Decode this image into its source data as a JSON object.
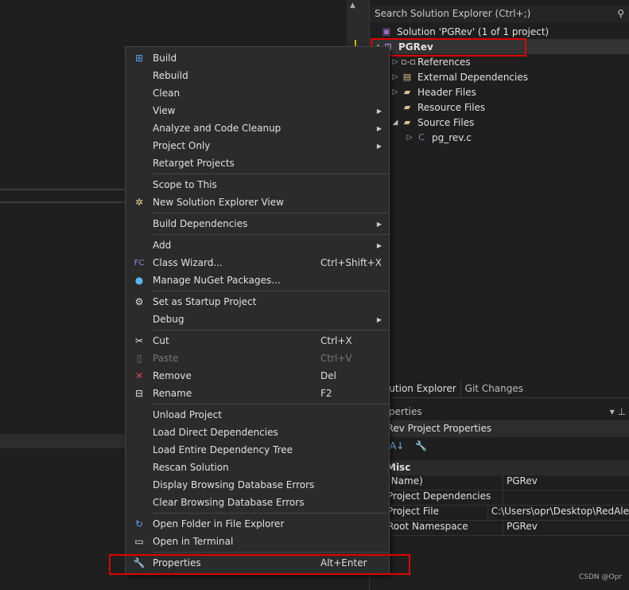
{
  "solution_explorer": {
    "search_placeholder": "Search Solution Explorer (Ctrl+;)",
    "solution": "Solution 'PGRev' (1 of 1 project)",
    "project": "PGRev",
    "items": [
      "References",
      "External Dependencies",
      "Header Files",
      "Resource Files",
      "Source Files"
    ],
    "file": "pg_rev.c"
  },
  "tabs": [
    "Solution Explorer",
    "Git Changes"
  ],
  "properties": {
    "title": "Properties",
    "header": "PGRev  Project Properties",
    "category": "Misc",
    "rows": [
      {
        "k": "(Name)",
        "v": "PGRev"
      },
      {
        "k": "Project Dependencies",
        "v": ""
      },
      {
        "k": "Project File",
        "v": "C:\\Users\\opr\\Desktop\\RedAle"
      },
      {
        "k": "Root Namespace",
        "v": "PGRev"
      }
    ]
  },
  "menu": {
    "build": "Build",
    "rebuild": "Rebuild",
    "clean": "Clean",
    "view": "View",
    "analyze": "Analyze and Code Cleanup",
    "project_only": "Project Only",
    "retarget": "Retarget Projects",
    "scope": "Scope to This",
    "new_view": "New Solution Explorer View",
    "build_deps": "Build Dependencies",
    "add": "Add",
    "class_wizard": "Class Wizard...",
    "class_wizard_sc": "Ctrl+Shift+X",
    "nuget": "Manage NuGet Packages...",
    "startup": "Set as Startup Project",
    "debug": "Debug",
    "cut": "Cut",
    "cut_sc": "Ctrl+X",
    "paste": "Paste",
    "paste_sc": "Ctrl+V",
    "remove": "Remove",
    "remove_sc": "Del",
    "rename": "Rename",
    "rename_sc": "F2",
    "unload": "Unload Project",
    "load_direct": "Load Direct Dependencies",
    "load_entire": "Load Entire Dependency Tree",
    "rescan": "Rescan Solution",
    "display_errors": "Display Browsing Database Errors",
    "clear_errors": "Clear Browsing Database Errors",
    "open_folder": "Open Folder in File Explorer",
    "open_terminal": "Open in Terminal",
    "properties": "Properties",
    "properties_sc": "Alt+Enter"
  },
  "watermark": "CSDN @Opr"
}
